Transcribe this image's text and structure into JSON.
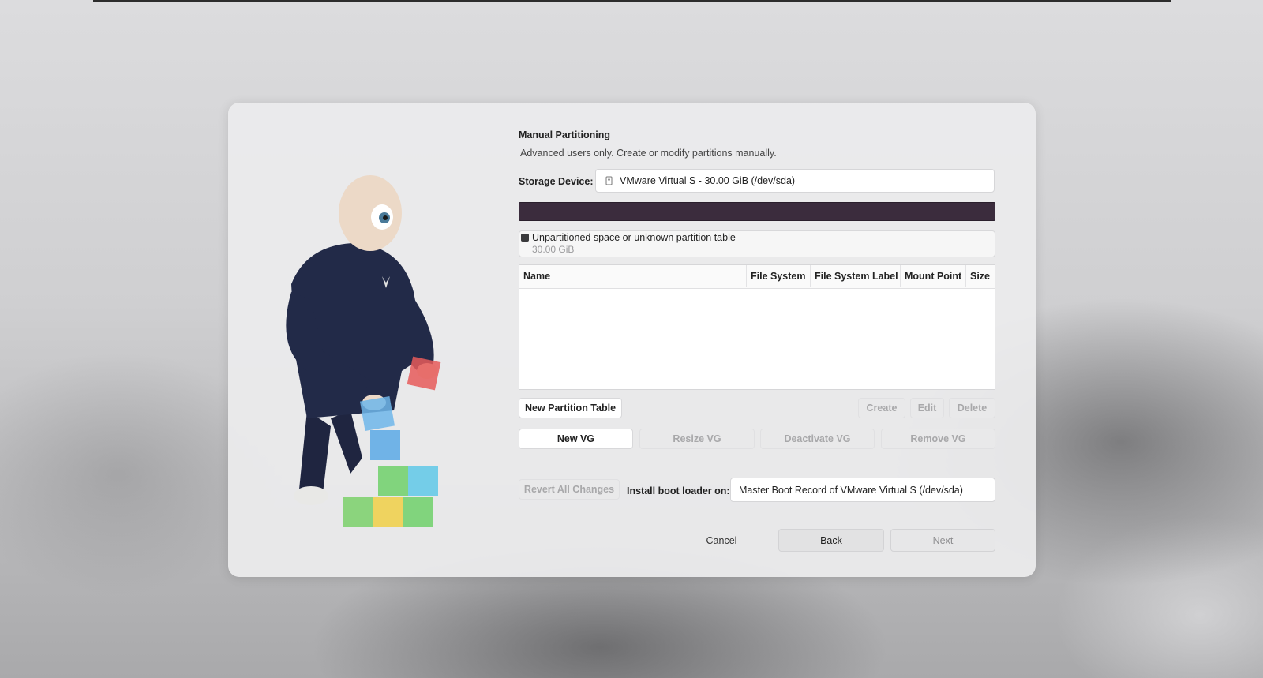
{
  "dialog": {
    "title": "Manual Partitioning",
    "subtitle": "Advanced users only. Create or modify partitions manually."
  },
  "storage": {
    "label": "Storage Device:",
    "device": "VMware Virtual S - 30.00 GiB (/dev/sda)",
    "icon": "disk-icon"
  },
  "partition_bar": {
    "color": "#3b2c3d",
    "used_fraction": 1.0
  },
  "legend": {
    "label": "Unpartitioned space or unknown partition table",
    "size": "30.00 GiB",
    "swatch_color": "#3a3a3c"
  },
  "table": {
    "columns": [
      "Name",
      "File System",
      "File System Label",
      "Mount Point",
      "Size"
    ],
    "rows": []
  },
  "actions": {
    "new_partition_table": "New Partition Table",
    "create": "Create",
    "edit": "Edit",
    "delete": "Delete",
    "new_vg": "New VG",
    "resize_vg": "Resize VG",
    "deactivate_vg": "Deactivate VG",
    "remove_vg": "Remove VG",
    "revert": "Revert All Changes"
  },
  "bootloader": {
    "label": "Install boot loader on:",
    "value": "Master Boot Record of VMware Virtual S (/dev/sda)"
  },
  "nav": {
    "cancel": "Cancel",
    "back": "Back",
    "next": "Next"
  }
}
